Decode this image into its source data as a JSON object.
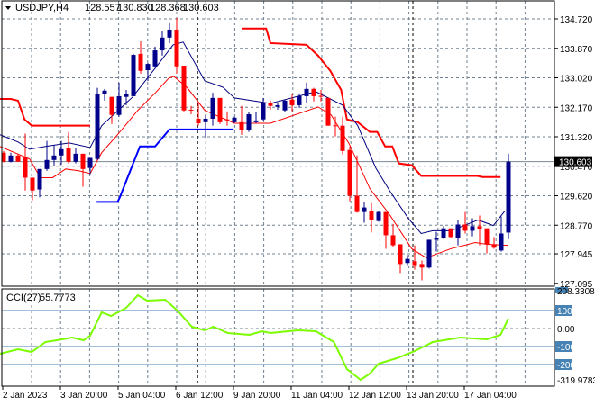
{
  "header": {
    "symbol_tf": "USDJPY,H4",
    "open": "128.557",
    "high": "130.830",
    "low": "128.368",
    "close": "130.603"
  },
  "cci_header": {
    "label": "CCI(27)",
    "value": "55.7773"
  },
  "colors": {
    "bull": "#00008b",
    "bear": "#ff0000",
    "ma_fast": "#000080",
    "ma_slow": "#ff0000",
    "upper_channel": "#ff0000",
    "lower_channel": "#0000ff",
    "cci": "#7cfc00",
    "grid": "#708090",
    "level_box": "#4682b4"
  },
  "chart_data": [
    {
      "type": "candlestick",
      "title": "USDJPY,H4",
      "ylim": [
        127.095,
        135.35
      ],
      "y_ticks": [
        "134.720",
        "133.870",
        "133.020",
        "132.170",
        "131.320",
        "130.470",
        "129.620",
        "128.770",
        "127.945",
        "127.095"
      ],
      "current_price": "130.603",
      "x_tick_labels": [
        {
          "label": "2 Jan 2023",
          "candle": 0
        },
        {
          "label": "3 Jan 20:00",
          "candle": 8
        },
        {
          "label": "5 Jan 04:00",
          "candle": 16
        },
        {
          "label": "6 Jan 12:00",
          "candle": 24
        },
        {
          "label": "9 Jan 20:00",
          "candle": 32
        },
        {
          "label": "11 Jan 04:00",
          "candle": 40
        },
        {
          "label": "12 Jan 12:00",
          "candle": 48
        },
        {
          "label": "13 Jan 20:00",
          "candle": 56
        },
        {
          "label": "17 Jan 04:00",
          "candle": 64
        }
      ],
      "period_separators": [
        26.9,
        56.75
      ],
      "candles_ohlc": [
        [
          130.86,
          130.91,
          130.58,
          130.6
        ],
        [
          130.6,
          130.86,
          130.58,
          130.78
        ],
        [
          130.78,
          130.83,
          130.6,
          130.6
        ],
        [
          130.73,
          131.41,
          129.77,
          130.14
        ],
        [
          130.14,
          130.14,
          129.49,
          129.77
        ],
        [
          129.8,
          130.39,
          129.57,
          130.39
        ],
        [
          130.39,
          131.2,
          130.34,
          130.65
        ],
        [
          130.65,
          131.07,
          130.47,
          130.78
        ],
        [
          130.78,
          131.2,
          130.52,
          130.96
        ],
        [
          130.99,
          131.46,
          130.55,
          130.6
        ],
        [
          130.6,
          130.99,
          130.55,
          130.83
        ],
        [
          130.83,
          130.83,
          129.88,
          130.39
        ],
        [
          130.42,
          130.71,
          130.24,
          130.71
        ],
        [
          130.68,
          132.73,
          130.65,
          132.54
        ],
        [
          132.54,
          132.7,
          132.36,
          132.65
        ],
        [
          132.47,
          132.47,
          131.69,
          131.95
        ],
        [
          131.95,
          132.88,
          131.9,
          132.49
        ],
        [
          132.47,
          132.67,
          132.23,
          132.54
        ],
        [
          132.49,
          133.71,
          132.49,
          133.68
        ],
        [
          133.71,
          134.07,
          133.14,
          133.22
        ],
        [
          133.24,
          133.45,
          132.93,
          133.42
        ],
        [
          133.35,
          133.92,
          133.32,
          133.81
        ],
        [
          133.81,
          134.36,
          133.66,
          134.18
        ],
        [
          134.18,
          134.62,
          134.02,
          134.41
        ],
        [
          134.41,
          134.75,
          133.14,
          133.35
        ],
        [
          133.37,
          133.37,
          132.05,
          132.08
        ],
        [
          132.1,
          132.21,
          131.97,
          132.08
        ],
        [
          131.84,
          132.28,
          131.64,
          131.71
        ],
        [
          131.74,
          131.95,
          131.3,
          131.84
        ],
        [
          131.84,
          132.59,
          131.64,
          132.44
        ],
        [
          132.44,
          132.44,
          131.69,
          131.74
        ],
        [
          131.82,
          132.05,
          131.64,
          131.8
        ],
        [
          131.74,
          131.9,
          131.71,
          131.87
        ],
        [
          131.74,
          132.21,
          131.38,
          131.51
        ],
        [
          131.51,
          132.03,
          131.46,
          131.97
        ],
        [
          131.74,
          132.03,
          131.71,
          131.79
        ],
        [
          131.82,
          132.44,
          131.79,
          132.28
        ],
        [
          132.28,
          132.36,
          132.1,
          132.21
        ],
        [
          132.18,
          132.28,
          132.1,
          132.23
        ],
        [
          132.08,
          132.39,
          132.03,
          132.36
        ],
        [
          132.39,
          132.54,
          132.05,
          132.23
        ],
        [
          132.23,
          132.57,
          132.16,
          132.49
        ],
        [
          132.49,
          132.88,
          132.28,
          132.7
        ],
        [
          132.7,
          132.73,
          132.34,
          132.49
        ],
        [
          132.5,
          132.67,
          132.34,
          132.49
        ],
        [
          132.44,
          132.44,
          131.64,
          131.64
        ],
        [
          131.65,
          131.9,
          131.33,
          131.64
        ],
        [
          131.64,
          131.9,
          130.81,
          130.91
        ],
        [
          130.94,
          131.04,
          129.46,
          129.62
        ],
        [
          129.62,
          130.78,
          129.13,
          129.15
        ],
        [
          129.15,
          129.44,
          128.84,
          129.28
        ],
        [
          129.18,
          129.41,
          128.56,
          128.92
        ],
        [
          128.89,
          129.18,
          128.87,
          129.15
        ],
        [
          129.15,
          129.15,
          128.09,
          128.48
        ],
        [
          128.48,
          128.81,
          128.14,
          128.19
        ],
        [
          128.22,
          128.22,
          127.39,
          127.65
        ],
        [
          127.68,
          127.91,
          127.62,
          127.8
        ],
        [
          127.73,
          128.19,
          127.49,
          127.62
        ],
        [
          127.65,
          127.75,
          127.18,
          127.55
        ],
        [
          127.55,
          128.35,
          127.52,
          128.35
        ],
        [
          128.35,
          128.58,
          128.01,
          128.4
        ],
        [
          128.4,
          128.74,
          128.37,
          128.68
        ],
        [
          128.68,
          128.68,
          128.4,
          128.43
        ],
        [
          128.4,
          128.92,
          128.19,
          128.79
        ],
        [
          128.79,
          129.15,
          128.53,
          128.61
        ],
        [
          128.61,
          128.97,
          128.45,
          128.74
        ],
        [
          128.74,
          129.05,
          128.19,
          128.66
        ],
        [
          128.68,
          128.68,
          127.96,
          128.22
        ],
        [
          128.22,
          128.43,
          128.09,
          128.12
        ],
        [
          128.04,
          129.02,
          128.01,
          128.53
        ],
        [
          128.557,
          130.83,
          128.368,
          130.603
        ]
      ],
      "series": [
        {
          "name": "upper_channel_a",
          "points": [
            [
              -0.5,
              132.41
            ],
            [
              1,
              132.41
            ],
            [
              2,
              132.36
            ],
            [
              2.9,
              131.82
            ],
            [
              3.9,
              131.64
            ],
            [
              12,
              131.64
            ]
          ]
        },
        {
          "name": "upper_channel_b",
          "points": [
            [
              33,
              134.44
            ],
            [
              36.4,
              134.44
            ],
            [
              37,
              134.02
            ],
            [
              42,
              133.97
            ],
            [
              43.6,
              133.66
            ],
            [
              45.3,
              133.22
            ],
            [
              46.8,
              132.67
            ],
            [
              47.6,
              131.82
            ],
            [
              49.1,
              131.74
            ],
            [
              50.8,
              131.46
            ],
            [
              51.8,
              131.46
            ],
            [
              52.9,
              131.04
            ],
            [
              53.9,
              131.04
            ],
            [
              54.8,
              130.55
            ],
            [
              56.6,
              130.5
            ],
            [
              57.9,
              130.19
            ],
            [
              65.7,
              130.19
            ],
            [
              66.4,
              130.16
            ],
            [
              68.9,
              130.16
            ]
          ]
        },
        {
          "name": "lower_channel",
          "points": [
            [
              12.9,
              129.44
            ],
            [
              15.8,
              129.44
            ],
            [
              16.1,
              129.57
            ],
            [
              17.9,
              130.52
            ],
            [
              18.9,
              131.04
            ],
            [
              21,
              131.04
            ],
            [
              23,
              131.53
            ],
            [
              31.9,
              131.53
            ]
          ]
        },
        {
          "name": "ma_fast",
          "points": [
            [
              -0.5,
              131.38
            ],
            [
              2,
              131.17
            ],
            [
              3.6,
              130.96
            ],
            [
              5.8,
              131.04
            ],
            [
              9.1,
              131.14
            ],
            [
              12,
              131.01
            ],
            [
              13.6,
              131.64
            ],
            [
              17.9,
              132.47
            ],
            [
              21.1,
              133.32
            ],
            [
              23.5,
              133.97
            ],
            [
              24.9,
              134.05
            ],
            [
              27.9,
              132.93
            ],
            [
              30.4,
              132.75
            ],
            [
              32,
              132.44
            ],
            [
              37,
              132.28
            ],
            [
              43.3,
              132.62
            ],
            [
              47,
              132.23
            ],
            [
              49.1,
              131.64
            ],
            [
              51.6,
              130.42
            ],
            [
              53.6,
              129.74
            ],
            [
              56.1,
              128.97
            ],
            [
              57.9,
              128.53
            ],
            [
              59.5,
              128.61
            ],
            [
              62,
              128.61
            ],
            [
              65.8,
              128.92
            ],
            [
              67.9,
              128.76
            ],
            [
              69.5,
              129.18
            ]
          ]
        },
        {
          "name": "ma_slow",
          "points": [
            [
              -0.5,
              131.04
            ],
            [
              3.6,
              130.68
            ],
            [
              5.1,
              130.14
            ],
            [
              6.8,
              130.14
            ],
            [
              8.6,
              130.39
            ],
            [
              10.4,
              130.34
            ],
            [
              12,
              130.26
            ],
            [
              13.6,
              130.86
            ],
            [
              15.8,
              131.38
            ],
            [
              18.6,
              132.08
            ],
            [
              21.1,
              132.6
            ],
            [
              22.9,
              133.01
            ],
            [
              23.6,
              133.06
            ],
            [
              25.4,
              132.75
            ],
            [
              27.9,
              132.08
            ],
            [
              32,
              131.71
            ],
            [
              37,
              131.71
            ],
            [
              43.6,
              132.18
            ],
            [
              45.4,
              131.95
            ],
            [
              47.9,
              131.12
            ],
            [
              50.8,
              129.82
            ],
            [
              53.6,
              129.05
            ],
            [
              56.6,
              128.09
            ],
            [
              58.6,
              127.83
            ],
            [
              62,
              128.09
            ],
            [
              65.4,
              128.27
            ],
            [
              67,
              128.22
            ],
            [
              69.9,
              128.19
            ]
          ]
        }
      ]
    },
    {
      "type": "line",
      "title": "CCI(27) 55.7773",
      "ylim": [
        -319.9783,
        208.3308
      ],
      "y_ticks": [
        "208.3308",
        "100",
        "0.00",
        "-100",
        "-200",
        "-319.9783"
      ],
      "levels": [
        100,
        0,
        -100,
        -200
      ],
      "series": [
        {
          "name": "CCI(27)",
          "points": [
            [
              -0.5,
              -140
            ],
            [
              2,
              -115
            ],
            [
              3.9,
              -130
            ],
            [
              5.8,
              -75
            ],
            [
              7.4,
              -65
            ],
            [
              9.5,
              -50
            ],
            [
              11.1,
              -65
            ],
            [
              12,
              -40
            ],
            [
              13.6,
              90
            ],
            [
              14.9,
              70
            ],
            [
              17,
              115
            ],
            [
              18.6,
              185
            ],
            [
              19.9,
              155
            ],
            [
              22.4,
              160
            ],
            [
              24.1,
              100
            ],
            [
              26.1,
              10
            ],
            [
              27.9,
              -10
            ],
            [
              29.1,
              10
            ],
            [
              31.1,
              -25
            ],
            [
              34.1,
              -35
            ],
            [
              35.8,
              -15
            ],
            [
              37,
              -25
            ],
            [
              40.8,
              -10
            ],
            [
              43.3,
              -15
            ],
            [
              45.8,
              -75
            ],
            [
              47.6,
              -225
            ],
            [
              49.5,
              -285
            ],
            [
              50.8,
              -250
            ],
            [
              52,
              -195
            ],
            [
              54.5,
              -165
            ],
            [
              57,
              -125
            ],
            [
              59.5,
              -75
            ],
            [
              63.3,
              -50
            ],
            [
              67,
              -60
            ],
            [
              68.9,
              -35
            ],
            [
              70,
              55.7773
            ]
          ]
        }
      ]
    }
  ]
}
